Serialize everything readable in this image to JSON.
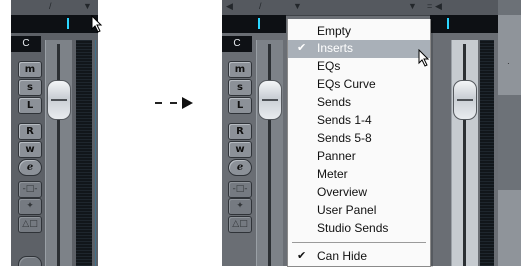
{
  "left_strip": {
    "channel_name": "C",
    "buttons": [
      "m",
      "s",
      "L",
      "R",
      "w",
      "e"
    ]
  },
  "right_strip": {
    "channel_name": "C",
    "buttons": [
      "m",
      "s",
      "L",
      "R",
      "w",
      "e"
    ]
  },
  "arrow": {
    "label": "- - ▶"
  },
  "menu": {
    "items": [
      {
        "label": "Empty",
        "checked": false,
        "selected": false
      },
      {
        "label": "Inserts",
        "checked": true,
        "selected": true
      },
      {
        "label": "EQs",
        "checked": false,
        "selected": false
      },
      {
        "label": "EQs Curve",
        "checked": false,
        "selected": false
      },
      {
        "label": "Sends",
        "checked": false,
        "selected": false
      },
      {
        "label": "Sends 1-4",
        "checked": false,
        "selected": false
      },
      {
        "label": "Sends 5-8",
        "checked": false,
        "selected": false
      },
      {
        "label": "Panner",
        "checked": false,
        "selected": false
      },
      {
        "label": "Meter",
        "checked": false,
        "selected": false
      },
      {
        "label": "Overview",
        "checked": false,
        "selected": false
      },
      {
        "label": "User Panel",
        "checked": false,
        "selected": false
      },
      {
        "label": "Studio Sends",
        "checked": false,
        "selected": false
      },
      {
        "label": "Can Hide",
        "checked": true,
        "selected": false
      }
    ],
    "check_glyph": "✔"
  },
  "colors": {
    "strip": "#5d6167",
    "insert_marker": "#2bd6ff",
    "menu_highlight": "#a9b0b8"
  },
  "icons": [
    "cursor-arrow-icon",
    "dropdown-triangle-icon",
    "checkmark-icon",
    "input-transformer-icon",
    "output-routing-icon",
    "channel-settings-icon"
  ]
}
